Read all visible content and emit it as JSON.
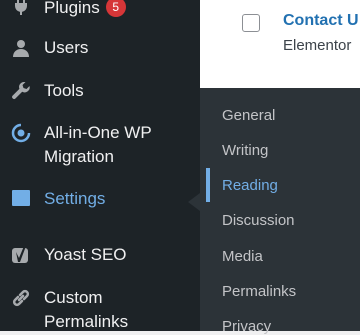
{
  "content": {
    "row_title": "Contact U",
    "row_subtitle": "Elementor"
  },
  "sidebar": {
    "items": [
      {
        "label": "Plugins",
        "badge": "5",
        "icon": "plugins-icon"
      },
      {
        "label": "Users",
        "icon": "users-icon"
      },
      {
        "label": "Tools",
        "icon": "tools-icon"
      },
      {
        "label": "All-in-One WP Migration",
        "line1": "All-in-One WP",
        "line2": "Migration",
        "icon": "migration-icon"
      },
      {
        "label": "Settings",
        "icon": "settings-icon",
        "current": true
      },
      {
        "label": "Yoast SEO",
        "icon": "yoast-icon"
      },
      {
        "label": "Custom Permalinks",
        "line1": "Custom",
        "line2": "Permalinks",
        "icon": "link-icon"
      }
    ]
  },
  "settings_submenu": {
    "items": [
      "General",
      "Writing",
      "Reading",
      "Discussion",
      "Media",
      "Permalinks",
      "Privacy"
    ],
    "active": "Reading"
  },
  "colors": {
    "sidebar_bg": "#1d2327",
    "flyout_bg": "#2c3338",
    "accent": "#72aee6",
    "badge": "#d63638",
    "link": "#2271b1"
  }
}
